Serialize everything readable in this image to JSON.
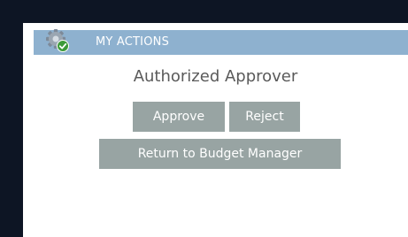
{
  "actions_panel": {
    "title": "MY ACTIONS",
    "header_icon": "gear-check-icon",
    "role": "Authorized Approver",
    "buttons": {
      "approve": "Approve",
      "reject": "Reject",
      "return_to_budget_manager": "Return to Budget Manager"
    }
  },
  "colors": {
    "background": "#0d1524",
    "panel": "#ffffff",
    "header": "#8eb1cf",
    "button": "#98a4a3",
    "icon_check": "#3c9a3a"
  }
}
